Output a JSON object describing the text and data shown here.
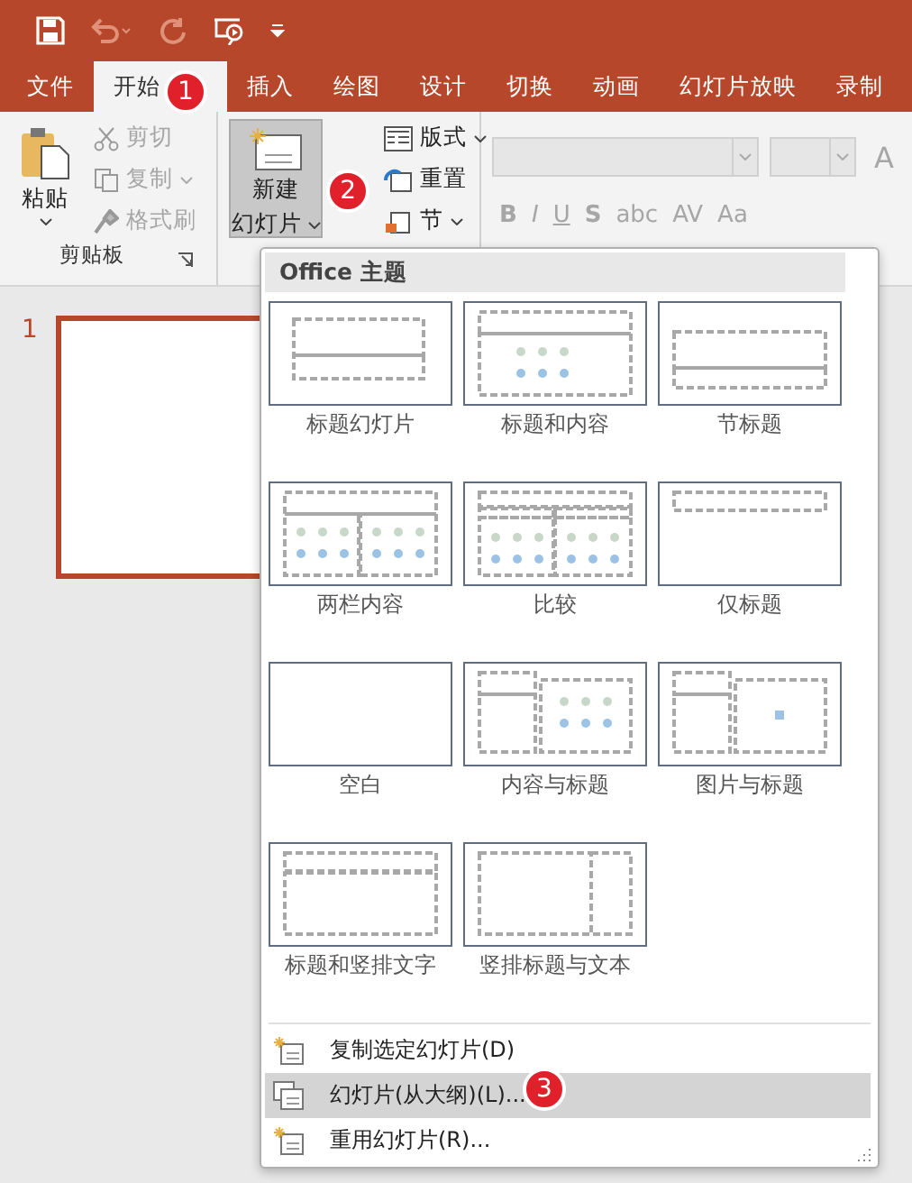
{
  "quick_access": {
    "undo_disabled": true
  },
  "tabs": [
    {
      "label": "文件",
      "selected": false
    },
    {
      "label": "开始",
      "selected": true,
      "badge": "1"
    },
    {
      "label": "插入",
      "selected": false
    },
    {
      "label": "绘图",
      "selected": false
    },
    {
      "label": "设计",
      "selected": false
    },
    {
      "label": "切换",
      "selected": false
    },
    {
      "label": "动画",
      "selected": false
    },
    {
      "label": "幻灯片放映",
      "selected": false
    },
    {
      "label": "录制",
      "selected": false
    }
  ],
  "clipboard": {
    "paste": "粘贴",
    "cut": "剪切",
    "copy": "复制",
    "format_painter": "格式刷",
    "group_label": "剪贴板"
  },
  "slides_group": {
    "new_slide": {
      "label": "新建",
      "label2": "幻灯片",
      "pressed": true,
      "badge": "2"
    },
    "layout": "版式",
    "reset": "重置",
    "section": "节"
  },
  "font_group": {
    "buttons": [
      "B",
      "I",
      "U",
      "S",
      "abc",
      "AV",
      "Aa"
    ],
    "grow": "A"
  },
  "slide_panel": {
    "number": "1"
  },
  "menu": {
    "header": "Office 主题",
    "layouts": [
      {
        "label": "标题幻灯片",
        "kind": "title"
      },
      {
        "label": "标题和内容",
        "kind": "title-content"
      },
      {
        "label": "节标题",
        "kind": "section"
      },
      {
        "label": "两栏内容",
        "kind": "two-content"
      },
      {
        "label": "比较",
        "kind": "comparison"
      },
      {
        "label": "仅标题",
        "kind": "title-only"
      },
      {
        "label": "空白",
        "kind": "blank"
      },
      {
        "label": "内容与标题",
        "kind": "content-caption"
      },
      {
        "label": "图片与标题",
        "kind": "picture-caption"
      },
      {
        "label": "标题和竖排文字",
        "kind": "title-vertical"
      },
      {
        "label": "竖排标题与文本",
        "kind": "vertical-title"
      }
    ],
    "items": [
      {
        "label": "复制选定幻灯片(D)",
        "selected": false
      },
      {
        "label": "幻灯片(从大纲)(L)...",
        "selected": true,
        "badge": "3"
      },
      {
        "label": "重用幻灯片(R)...",
        "selected": false
      }
    ]
  }
}
